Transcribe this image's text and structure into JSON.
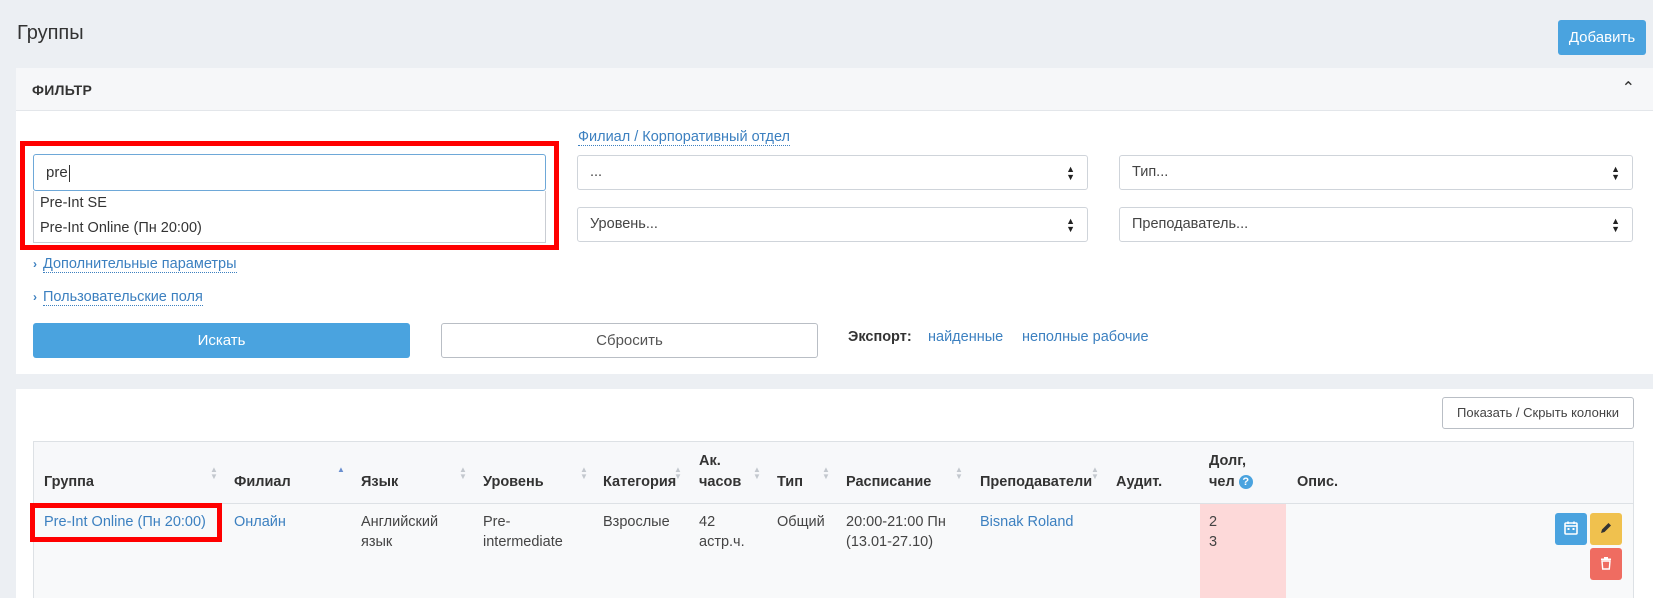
{
  "page": {
    "title": "Группы",
    "add_label": "Добавить"
  },
  "filter": {
    "title": "ФИЛЬТР",
    "search_value": "pre",
    "suggestions": [
      "Pre-Int SE",
      "Pre-Int Online (Пн 20:00)"
    ],
    "branch_label": "Филиал / Корпоративный отдел",
    "branch_select": "...",
    "type_select": "Тип...",
    "level_select": "Уровень...",
    "teacher_select": "Преподаватель...",
    "additional_params": "Дополнительные параметры",
    "custom_fields": "Пользовательские поля",
    "search_button": "Искать",
    "reset_button": "Сбросить",
    "export_label": "Экспорт:",
    "export_found": "найденные",
    "export_incomplete": "неполные рабочие"
  },
  "table": {
    "toggle_columns": "Показать / Скрыть колонки",
    "headers": {
      "group": "Группа",
      "branch": "Филиал",
      "language": "Язык",
      "level": "Уровень",
      "category": "Категория",
      "hours_1": "Ак.",
      "hours_2": "часов",
      "type": "Тип",
      "schedule": "Расписание",
      "teachers": "Преподаватели",
      "room": "Аудит.",
      "debt_1": "Долг,",
      "debt_2": "чел",
      "description": "Опис."
    },
    "rows": [
      {
        "group": "Pre-Int Online (Пн 20:00)",
        "branch": "Онлайн",
        "language_1": "Английский",
        "language_2": "язык",
        "level_1": "Pre-",
        "level_2": "intermediate",
        "category": "Взрослые",
        "hours_1": "42",
        "hours_2": "астр.ч.",
        "type": "Общий",
        "schedule_1": "20:00-21:00 Пн",
        "schedule_2": "(13.01-27.10)",
        "teacher": "Bisnak Roland",
        "debt_1": "2",
        "debt_2": "3"
      }
    ]
  },
  "colors": {
    "accent": "#4aa3df",
    "highlight": "#ff0000",
    "debt_bg": "#fdd9d9"
  }
}
